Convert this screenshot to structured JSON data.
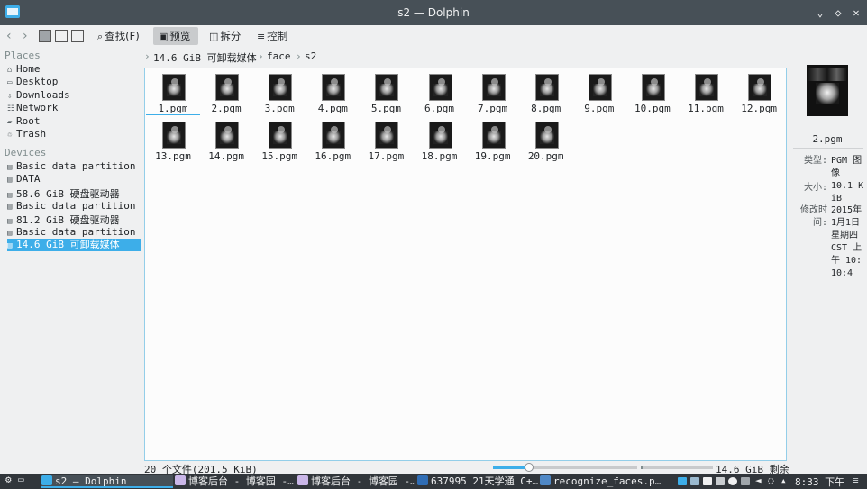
{
  "window": {
    "title": "s2 — Dolphin",
    "buttons": [
      "⌄",
      "◇",
      "✕"
    ]
  },
  "toolbar": {
    "back": "‹",
    "forward": "›",
    "find_label": "查找(F)",
    "preview_label": "预览",
    "split_label": "拆分",
    "control_label": "控制"
  },
  "sidebar": {
    "places_header": "Places",
    "places": [
      {
        "label": "Home",
        "icon": "home-icon"
      },
      {
        "label": "Desktop",
        "icon": "desktop-icon"
      },
      {
        "label": "Downloads",
        "icon": "downloads-icon"
      },
      {
        "label": "Network",
        "icon": "network-icon"
      },
      {
        "label": "Root",
        "icon": "root-icon"
      },
      {
        "label": "Trash",
        "icon": "trash-icon"
      }
    ],
    "devices_header": "Devices",
    "devices": [
      {
        "label": "Basic data partition",
        "icon": "drive-icon"
      },
      {
        "label": "DATA",
        "icon": "drive-icon"
      },
      {
        "label": "58.6 GiB 硬盘驱动器",
        "icon": "drive-icon"
      },
      {
        "label": "Basic data partition",
        "icon": "drive-icon"
      },
      {
        "label": "81.2 GiB 硬盘驱动器",
        "icon": "drive-icon"
      },
      {
        "label": "Basic data partition",
        "icon": "drive-icon"
      },
      {
        "label": "14.6 GiB 可卸载媒体",
        "icon": "usb-drive-icon",
        "selected": true
      }
    ]
  },
  "breadcrumb": {
    "parts": [
      "14.6 GiB 可卸载媒体",
      "face",
      "s2"
    ],
    "separator": "›"
  },
  "files": [
    "1.pgm",
    "2.pgm",
    "3.pgm",
    "4.pgm",
    "5.pgm",
    "6.pgm",
    "7.pgm",
    "8.pgm",
    "9.pgm",
    "10.pgm",
    "11.pgm",
    "12.pgm",
    "13.pgm",
    "14.pgm",
    "15.pgm",
    "16.pgm",
    "17.pgm",
    "18.pgm",
    "19.pgm",
    "20.pgm"
  ],
  "info_panel": {
    "filename": "2.pgm",
    "type_label": "类型:",
    "type_value": "PGM 图像",
    "size_label": "大小:",
    "size_value": "10.1 KiB",
    "modified_label": "修改时间:",
    "modified_value": "2015年1月1日星期四 CST 上午 10:10:4"
  },
  "status": {
    "count": "20 个文件(201.5 KiB)",
    "free": "14.6 GiB 剩余",
    "zoom_fraction": 0.25,
    "space_used_fraction": 0.03
  },
  "taskbar": {
    "tasks": [
      {
        "label": "s2 — Dolphin",
        "icon": "folder-icon",
        "active": true
      },
      {
        "label": "博客后台 - 博客园 -…",
        "icon": "browser-icon"
      },
      {
        "label": "博客后台 - 博客园 -…",
        "icon": "browser-icon"
      },
      {
        "label": "637995 21天学通 C+…",
        "icon": "editor-icon"
      },
      {
        "label": "recognize_faces.p…",
        "icon": "python-icon"
      }
    ],
    "clock": "8:33 下午"
  },
  "colors": {
    "accent": "#3daee9",
    "titlebar": "#475057",
    "taskbar": "#31363b"
  }
}
